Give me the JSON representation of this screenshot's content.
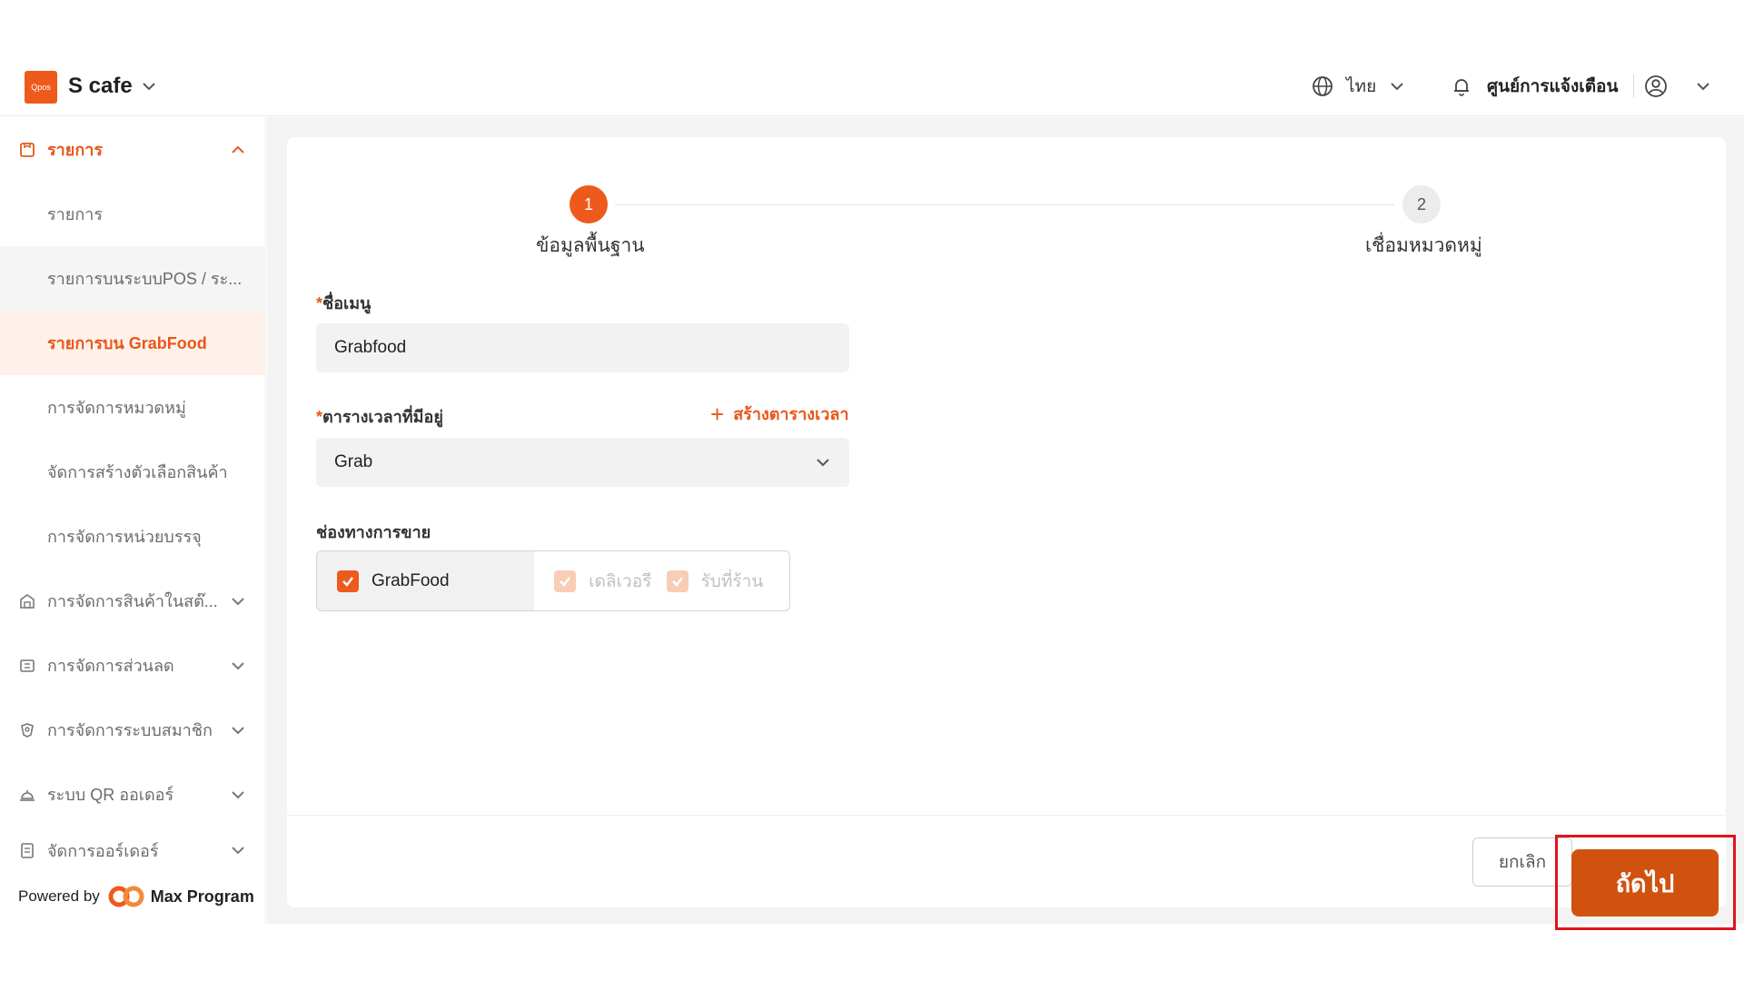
{
  "header": {
    "logo_text": "Qpos",
    "store_name": "S cafe",
    "language": "ไทย",
    "notifications": "ศูนย์การแจ้งเตือน"
  },
  "sidebar": {
    "items": [
      {
        "label": "รายการ",
        "icon": "menu-list-icon",
        "state": "expanded"
      },
      {
        "label": "รายการ",
        "type": "sub"
      },
      {
        "label": "รายการบนระบบPOS / ระ...",
        "type": "sub"
      },
      {
        "label": "รายการบน GrabFood",
        "type": "sub",
        "state": "selected"
      },
      {
        "label": "การจัดการหมวดหมู่",
        "type": "sub"
      },
      {
        "label": "จัดการสร้างตัวเลือกสินค้า",
        "type": "sub"
      },
      {
        "label": "การจัดการหน่วยบรรจุ",
        "type": "sub"
      },
      {
        "label": "การจัดการสินค้าในสต๊...",
        "icon": "warehouse-icon"
      },
      {
        "label": "การจัดการส่วนลด",
        "icon": "coupon-icon"
      },
      {
        "label": "การจัดการระบบสมาชิก",
        "icon": "member-icon"
      },
      {
        "label": "ระบบ QR ออเดอร์",
        "icon": "service-bell-icon"
      },
      {
        "label": "จัดการออร์เดอร์",
        "icon": "order-clipboard-icon"
      }
    ],
    "powered_by": "Powered by",
    "powered_brand": "Max Program"
  },
  "stepper": {
    "steps": [
      {
        "number": "1",
        "label": "ข้อมูลพื้นฐาน",
        "state": "active"
      },
      {
        "number": "2",
        "label": "เชื่อมหมวดหมู่",
        "state": "pending"
      }
    ]
  },
  "form": {
    "menu_name_label": "ชื่อเมนู",
    "menu_name_value": "Grabfood",
    "schedule_label": "ตารางเวลาที่มีอยู่",
    "create_schedule": "สร้างตารางเวลา",
    "schedule_value": "Grab",
    "channel_label": "ช่องทางการขาย",
    "required_mark": "*",
    "channels": [
      {
        "label": "GrabFood",
        "checked": true,
        "disabled": false
      },
      {
        "label": "เดลิเวอรี",
        "checked": true,
        "disabled": true
      },
      {
        "label": "รับที่ร้าน",
        "checked": true,
        "disabled": true
      }
    ]
  },
  "footer": {
    "cancel": "ยกเลิก",
    "next": "ถัดไป"
  },
  "colors": {
    "accent": "#ee5a1c",
    "next_button": "#d1520f",
    "highlight": "#e0141c"
  }
}
